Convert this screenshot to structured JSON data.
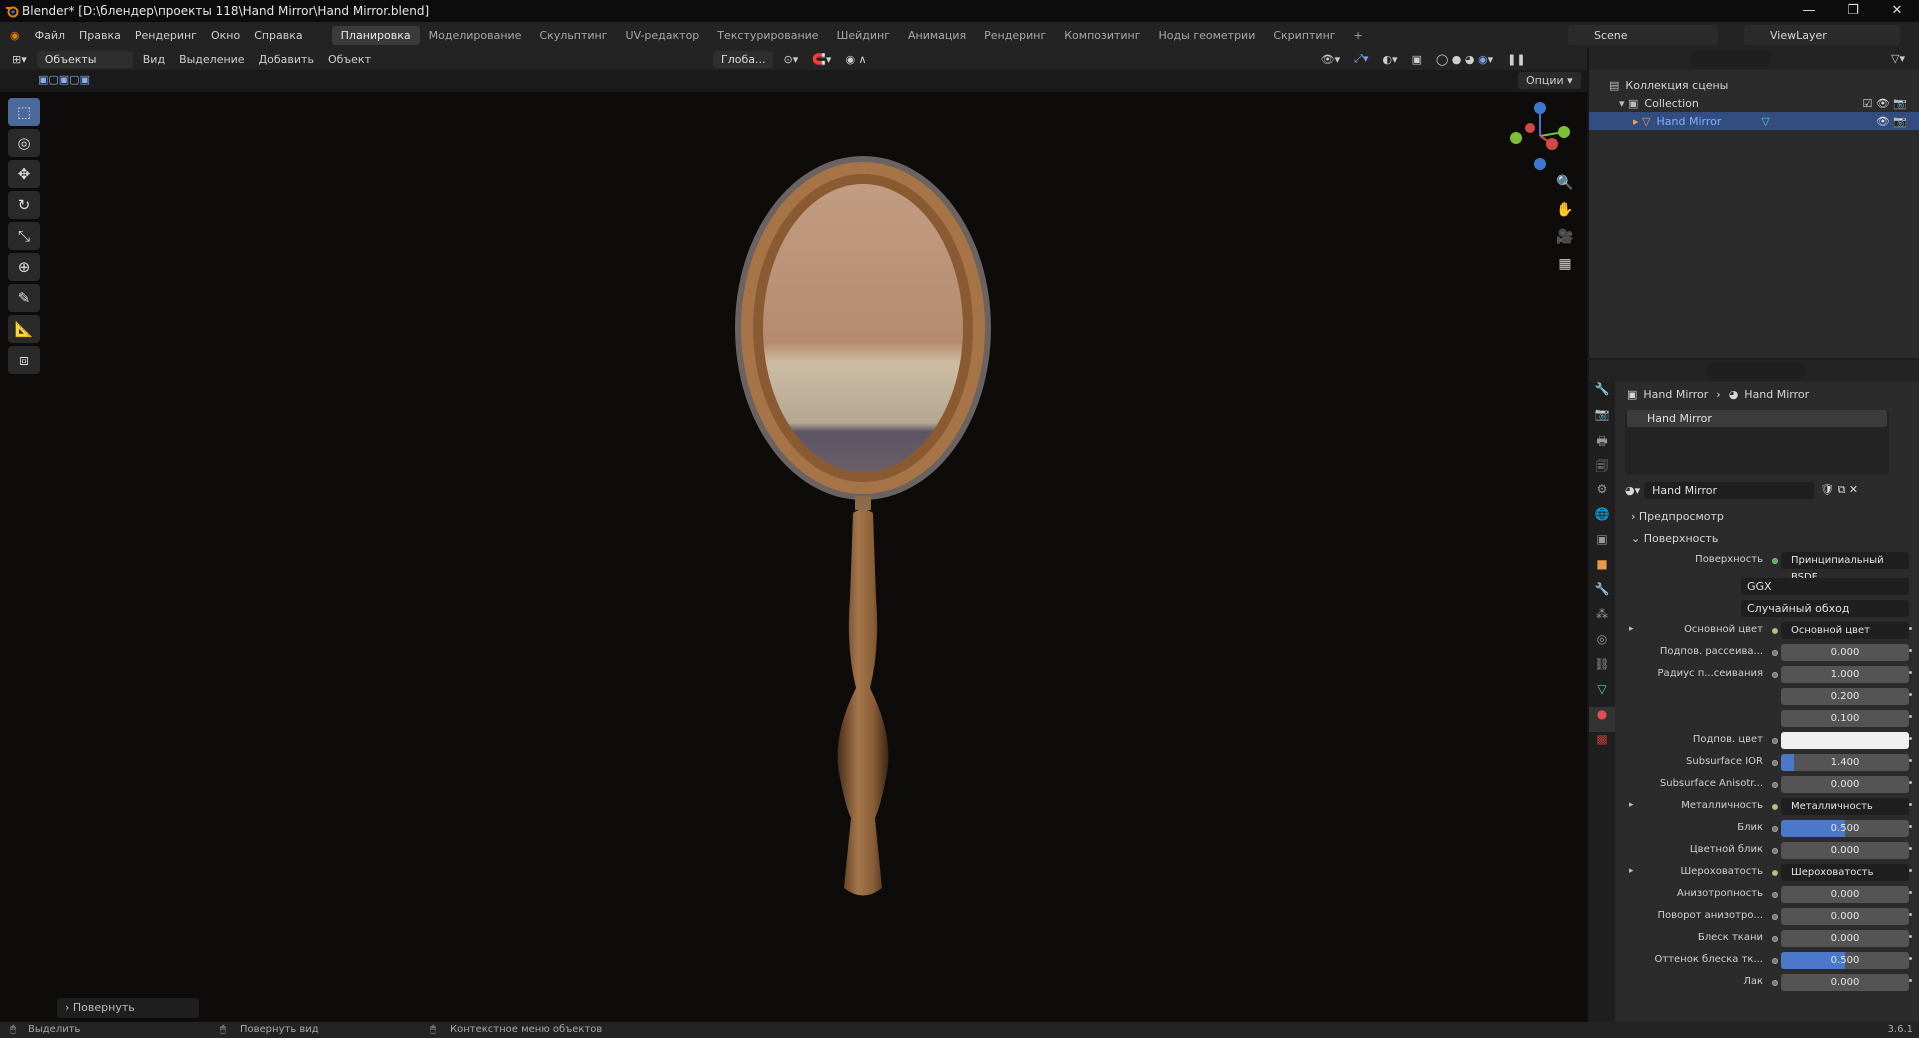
{
  "title": "Blender* [D:\\блендер\\проекты 118\\Hand Mirror\\Hand Mirror.blend]",
  "window": {
    "minimize": "—",
    "restore": "❐",
    "close": "✕"
  },
  "menu": [
    "Файл",
    "Правка",
    "Рендеринг",
    "Окно",
    "Справка"
  ],
  "workspaces": [
    "Планировка",
    "Моделирование",
    "Скульптинг",
    "UV-редактор",
    "Текстурирование",
    "Шейдинг",
    "Анимация",
    "Рендеринг",
    "Композитинг",
    "Ноды геометрии",
    "Скриптинг"
  ],
  "scene": "Scene",
  "view_layer": "ViewLayer",
  "viewport_header": {
    "mode": "Объекты",
    "view": "Вид",
    "select": "Выделение",
    "add": "Добавить",
    "object": "Объект",
    "transform": "Глоба...",
    "options": "Опции"
  },
  "last_operator": "Повернуть",
  "status": {
    "select": "Выделить",
    "rotate_view": "Повернуть вид",
    "context_menu": "Контекстное меню объектов",
    "version": "3.6.1"
  },
  "outliner": {
    "scene_collection": "Коллекция сцены",
    "collection": "Collection",
    "object": "Hand Mirror"
  },
  "properties": {
    "breadcrumb_object": "Hand Mirror",
    "breadcrumb_material": "Hand Mirror",
    "slot": "Hand Mirror",
    "material": "Hand Mirror",
    "preview": "Предпросмотр",
    "surface_panel": "Поверхность",
    "surface_label": "Поверхность",
    "surface_value": "Принципиальный BSDF",
    "distribution": "GGX",
    "subsurface_method": "Случайный обход",
    "rows": [
      {
        "label": "Основной цвет",
        "value": "Основной цвет",
        "kind": "link"
      },
      {
        "label": "Подпов. рассеива...",
        "value": "0.000",
        "kind": "num"
      },
      {
        "label": "Радиус п...сеивания",
        "value": "1.000",
        "kind": "num"
      },
      {
        "label": "",
        "value": "0.200",
        "kind": "num"
      },
      {
        "label": "",
        "value": "0.100",
        "kind": "num"
      },
      {
        "label": "Подпов. цвет",
        "value": "",
        "kind": "color"
      },
      {
        "label": "Subsurface IOR",
        "value": "1.400",
        "kind": "num",
        "fill": 0.1
      },
      {
        "label": "Subsurface Anisotr...",
        "value": "0.000",
        "kind": "num"
      },
      {
        "label": "Металличность",
        "value": "Металличность",
        "kind": "link"
      },
      {
        "label": "Блик",
        "value": "0.500",
        "kind": "num",
        "fill": 0.5
      },
      {
        "label": "Цветной блик",
        "value": "0.000",
        "kind": "num"
      },
      {
        "label": "Шероховатость",
        "value": "Шероховатость",
        "kind": "link"
      },
      {
        "label": "Анизотропность",
        "value": "0.000",
        "kind": "num"
      },
      {
        "label": "Поворот анизотро...",
        "value": "0.000",
        "kind": "num"
      },
      {
        "label": "Блеск ткани",
        "value": "0.000",
        "kind": "num"
      },
      {
        "label": "Оттенок блеска тк...",
        "value": "0.500",
        "kind": "num",
        "fill": 0.5
      },
      {
        "label": "Лак",
        "value": "0.000",
        "kind": "num"
      }
    ]
  }
}
